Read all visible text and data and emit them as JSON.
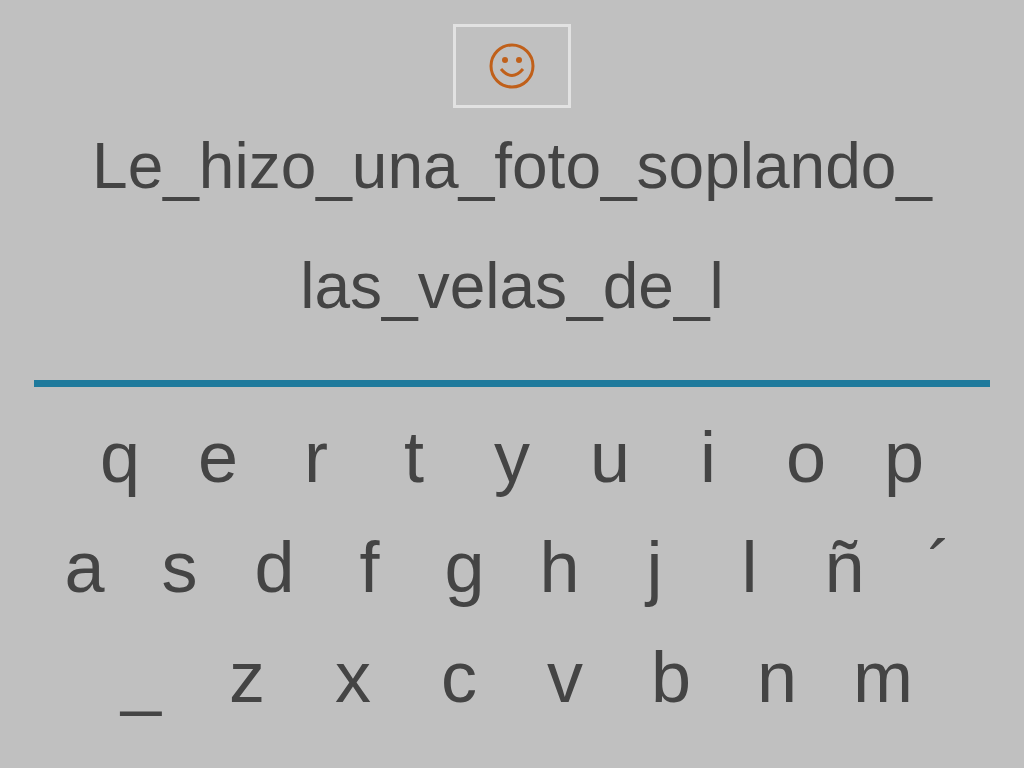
{
  "phrase_lines": [
    "Le_hizo_una_foto_soplando_",
    "las_velas_de_l"
  ],
  "keyboard": {
    "rows": [
      [
        "q",
        "e",
        "r",
        "t",
        "y",
        "u",
        "i",
        "o",
        "p"
      ],
      [
        "a",
        "s",
        "d",
        "f",
        "g",
        "h",
        "j",
        "l",
        "ñ",
        "´"
      ],
      [
        "_",
        "z",
        "x",
        "c",
        "v",
        "b",
        "n",
        "m"
      ]
    ]
  }
}
